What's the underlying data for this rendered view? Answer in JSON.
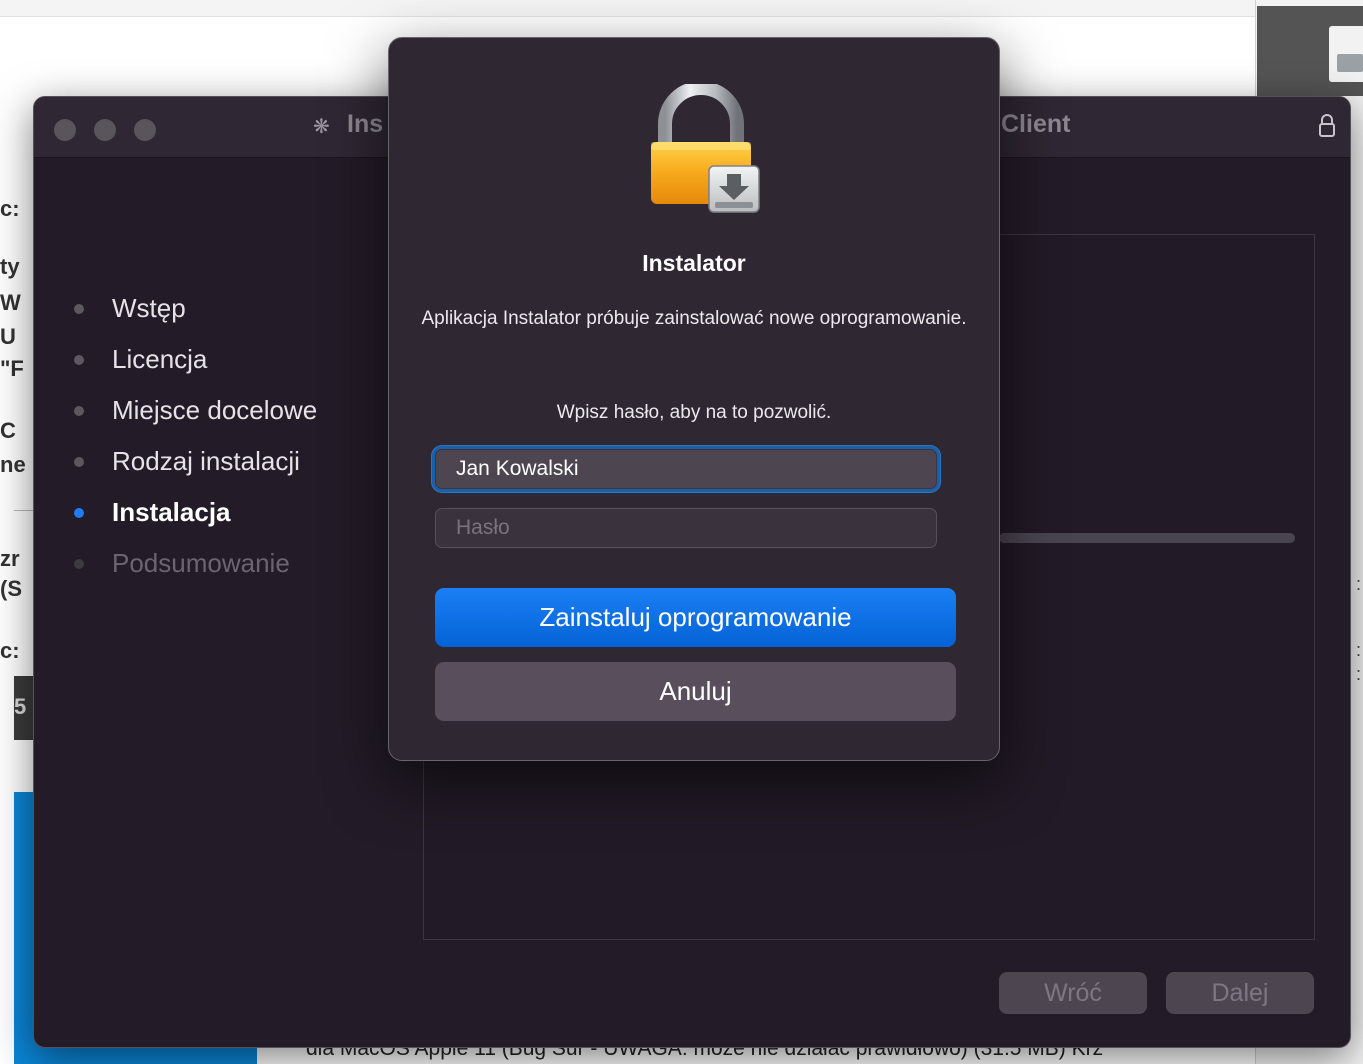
{
  "background": {
    "left_fragments": [
      "c:",
      "ty",
      "W",
      "U",
      "\"F",
      "C",
      "ne",
      "zr",
      "(S",
      "c:",
      "5"
    ],
    "bottom_text": "dla MacOS Apple 11 (Bug Sur - UWAGA: może nie działać prawidłowo) (31.5 MB) Krz"
  },
  "installer_window": {
    "title_left": "Ins",
    "title_right": "Client",
    "steps": [
      {
        "label": "Wstęp",
        "state": "done"
      },
      {
        "label": "Licencja",
        "state": "done"
      },
      {
        "label": "Miejsce docelowe",
        "state": "done"
      },
      {
        "label": "Rodzaj instalacji",
        "state": "done"
      },
      {
        "label": "Instalacja",
        "state": "active"
      },
      {
        "label": "Podsumowanie",
        "state": "pending"
      }
    ],
    "back_label": "Wróć",
    "continue_label": "Dalej"
  },
  "auth_dialog": {
    "icon": "lock-installer-icon",
    "title": "Instalator",
    "message": "Aplikacja Instalator próbuje zainstalować nowe oprogramowanie.",
    "prompt": "Wpisz hasło, aby na to pozwolić.",
    "username_value": "Jan Kowalski",
    "password_placeholder": "Hasło",
    "install_label": "Zainstaluj oprogramowanie",
    "cancel_label": "Anuluj"
  },
  "colors": {
    "accent": "#0a6fe0",
    "window_bg": "#231b27",
    "dialog_bg": "#2f2731"
  }
}
